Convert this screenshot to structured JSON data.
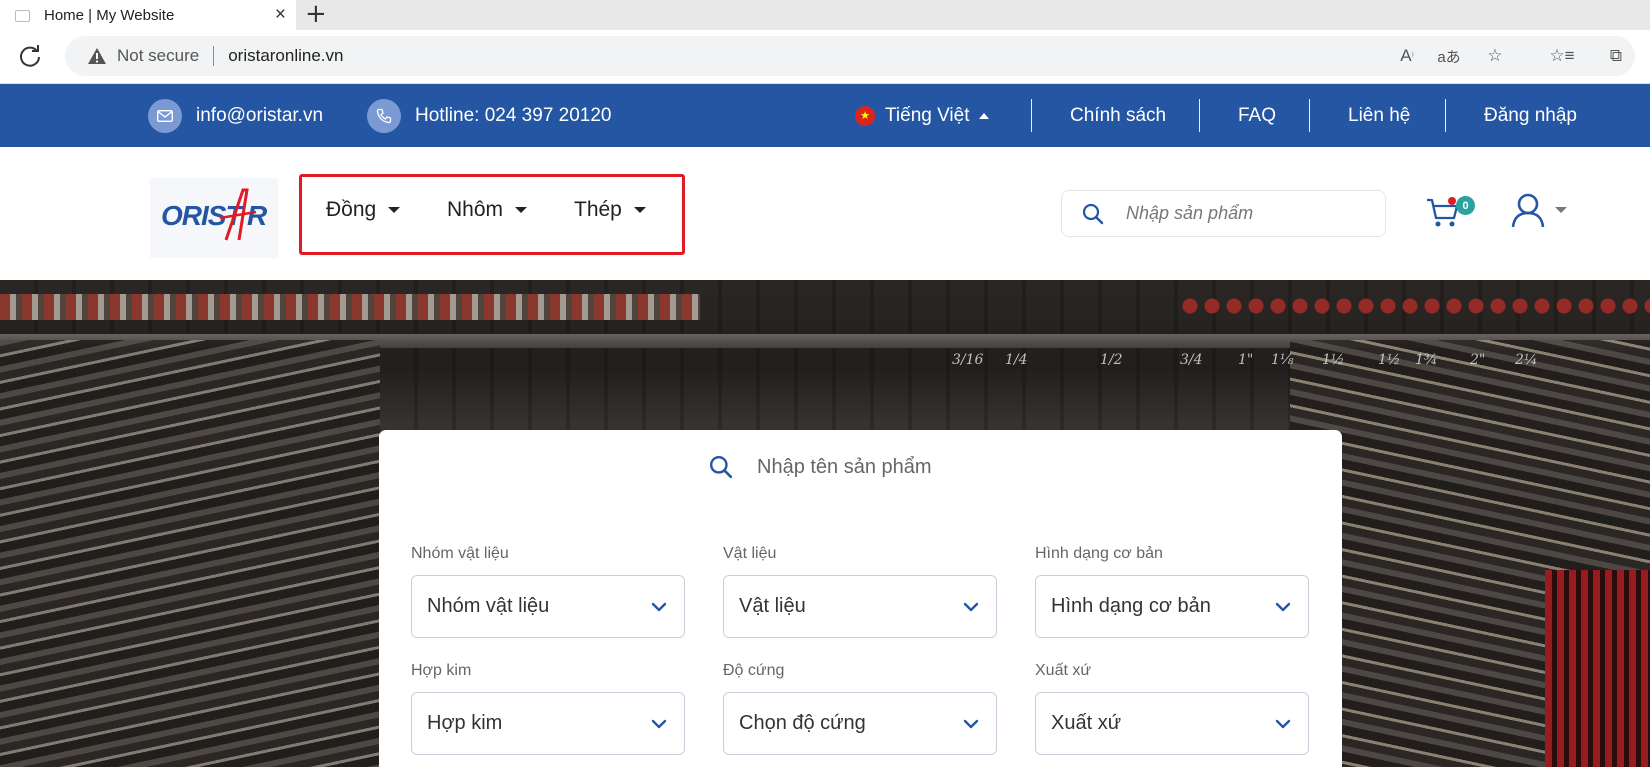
{
  "browser": {
    "tab_title": "Home | My Website",
    "security_label": "Not secure",
    "url": "oristaronline.vn",
    "icons": [
      "reload-icon",
      "warning-icon",
      "read-aloud-icon",
      "translate-icon",
      "add-favorite-icon",
      "favorites-icon",
      "collections-icon"
    ]
  },
  "topbar": {
    "email": "info@oristar.vn",
    "hotline": "Hotline: 024 397 20120",
    "language": "Tiếng Việt",
    "links": [
      "Chính sách",
      "FAQ",
      "Liên hệ",
      "Đăng nhập"
    ],
    "colors": {
      "background": "#2456a4",
      "icon_circle": "#7b9ad4"
    }
  },
  "header": {
    "logo_text": "ORISTAR",
    "nav": [
      "Đồng",
      "Nhôm",
      "Thép"
    ],
    "search_placeholder": "Nhập sản phẩm",
    "cart_count": "0",
    "colors": {
      "highlight_border": "#e01b24",
      "badge": "#2aa3a0",
      "brand_blue": "#2456a4"
    }
  },
  "filter": {
    "search_placeholder": "Nhập tên sản phẩm",
    "fields": [
      {
        "label": "Nhóm vật liệu",
        "value": "Nhóm vật liệu"
      },
      {
        "label": "Vật liệu",
        "value": "Vật liệu"
      },
      {
        "label": "Hình dạng cơ bản",
        "value": "Hình dạng cơ bản"
      },
      {
        "label": "Hợp kim",
        "value": "Hợp kim"
      },
      {
        "label": "Độ cứng",
        "value": "Chọn độ cứng"
      },
      {
        "label": "Xuất xứ",
        "value": "Xuất xứ"
      }
    ]
  },
  "hero": {
    "shelf_sizes": [
      "3/16",
      "1/4",
      "1/2",
      "3/4",
      "1\"",
      "1⅛",
      "1½",
      "1¾",
      "2\"",
      "2¼"
    ]
  }
}
